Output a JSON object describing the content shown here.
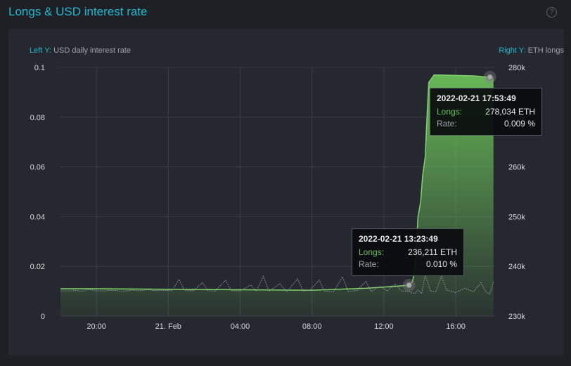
{
  "header": {
    "title": "Longs & USD interest rate",
    "help_icon": "?"
  },
  "captions": {
    "left_key": "Left Y:",
    "left_text": "USD daily interest rate",
    "right_key": "Right Y:",
    "right_text": "ETH longs"
  },
  "tooltips": [
    {
      "date": "2022-02-21 13:23:49",
      "longs_label": "Longs:",
      "longs_value": "236,211 ETH",
      "rate_label": "Rate:",
      "rate_value": "0.010 %"
    },
    {
      "date": "2022-02-21 17:53:49",
      "longs_label": "Longs:",
      "longs_value": "278,034 ETH",
      "rate_label": "Rate:",
      "rate_value": "0.009 %"
    }
  ],
  "chart_data": {
    "type": "line",
    "x_unit": "hours since 2022-02-20 18:00",
    "xlim": [
      0,
      24.15
    ],
    "x_ticks": [
      {
        "x": 2,
        "label": "20:00"
      },
      {
        "x": 6,
        "label": "21. Feb"
      },
      {
        "x": 10,
        "label": "04:00"
      },
      {
        "x": 14,
        "label": "08:00"
      },
      {
        "x": 18,
        "label": "12:00"
      },
      {
        "x": 22,
        "label": "16:00"
      }
    ],
    "left_axis": {
      "label": "USD daily interest rate",
      "ylim": [
        0,
        0.1
      ],
      "ticks": [
        "0",
        "0.02",
        "0.04",
        "0.06",
        "0.08",
        "0.1"
      ]
    },
    "right_axis": {
      "label": "ETH longs",
      "ylim": [
        230,
        280
      ],
      "ticks": [
        "230k",
        "240k",
        "250k",
        "260k",
        "270k",
        "280k"
      ]
    },
    "series": [
      {
        "name": "Longs",
        "axis": "right",
        "color": "#7fd36a",
        "points": [
          [
            0,
            235.5
          ],
          [
            2,
            235.5
          ],
          [
            6,
            235.4
          ],
          [
            10,
            235.3
          ],
          [
            14,
            235.2
          ],
          [
            17,
            235.6
          ],
          [
            19.4,
            236.2
          ],
          [
            19.6,
            237
          ],
          [
            19.75,
            240
          ],
          [
            19.9,
            250
          ],
          [
            20.05,
            253
          ],
          [
            20.15,
            258
          ],
          [
            20.3,
            262
          ],
          [
            20.4,
            270
          ],
          [
            20.5,
            277
          ],
          [
            20.8,
            278.5
          ],
          [
            22,
            278.4
          ],
          [
            23,
            278.3
          ],
          [
            23.9,
            278.03
          ],
          [
            24.1,
            278.0
          ]
        ]
      },
      {
        "name": "Rate",
        "axis": "left",
        "color": "#9a9da2",
        "points": [
          [
            0,
            0.0102
          ],
          [
            0.4,
            0.0101
          ],
          [
            0.8,
            0.0103
          ],
          [
            1.2,
            0.01
          ],
          [
            1.6,
            0.0108
          ],
          [
            2,
            0.0102
          ],
          [
            2.4,
            0.0101
          ],
          [
            2.8,
            0.0104
          ],
          [
            3.2,
            0.0102
          ],
          [
            3.6,
            0.01
          ],
          [
            4,
            0.0105
          ],
          [
            4.4,
            0.0101
          ],
          [
            4.8,
            0.0107
          ],
          [
            5.2,
            0.0102
          ],
          [
            5.6,
            0.0104
          ],
          [
            6.2,
            0.0102
          ],
          [
            6.6,
            0.0148
          ],
          [
            6.9,
            0.0103
          ],
          [
            7.4,
            0.0102
          ],
          [
            7.9,
            0.0135
          ],
          [
            8.2,
            0.0103
          ],
          [
            8.6,
            0.01
          ],
          [
            9.2,
            0.0145
          ],
          [
            9.5,
            0.0102
          ],
          [
            10,
            0.0101
          ],
          [
            10.6,
            0.0125
          ],
          [
            10.9,
            0.0101
          ],
          [
            11.3,
            0.016
          ],
          [
            11.6,
            0.01
          ],
          [
            12.2,
            0.013
          ],
          [
            12.6,
            0.0098
          ],
          [
            13.2,
            0.015
          ],
          [
            13.5,
            0.0101
          ],
          [
            13.9,
            0.0105
          ],
          [
            14.4,
            0.0145
          ],
          [
            14.7,
            0.01
          ],
          [
            15.2,
            0.0098
          ],
          [
            15.7,
            0.0158
          ],
          [
            16,
            0.01
          ],
          [
            16.5,
            0.0103
          ],
          [
            17,
            0.014
          ],
          [
            17.3,
            0.0099
          ],
          [
            17.8,
            0.012
          ],
          [
            18.2,
            0.0101
          ],
          [
            18.6,
            0.013
          ],
          [
            19,
            0.01
          ],
          [
            19.4,
            0.01
          ],
          [
            19.7,
            0.009
          ],
          [
            19.9,
            0.0105
          ],
          [
            20.1,
            0.009
          ],
          [
            20.3,
            0.0165
          ],
          [
            20.6,
            0.01
          ],
          [
            20.9,
            0.0098
          ],
          [
            21.2,
            0.016
          ],
          [
            21.5,
            0.0105
          ],
          [
            22,
            0.0095
          ],
          [
            22.5,
            0.0112
          ],
          [
            23,
            0.0098
          ],
          [
            23.4,
            0.0135
          ],
          [
            23.7,
            0.0095
          ],
          [
            23.9,
            0.009
          ],
          [
            24.1,
            0.0138
          ]
        ]
      }
    ],
    "highlighted_points": [
      {
        "x": 19.4,
        "longs": 236.211,
        "rate": 0.01
      },
      {
        "x": 23.9,
        "longs": 278.034,
        "rate": 0.009
      }
    ]
  }
}
